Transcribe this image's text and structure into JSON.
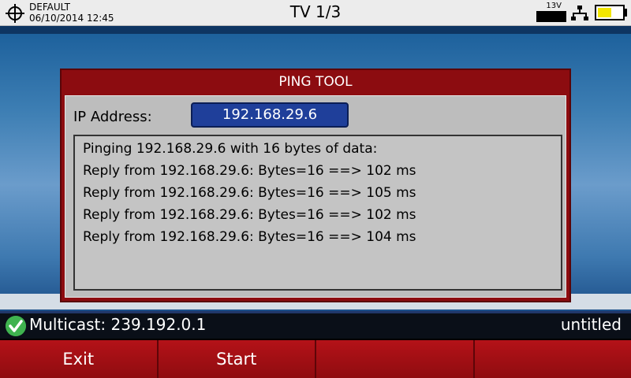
{
  "topbar": {
    "profile_name": "DEFAULT",
    "datetime": "06/10/2014 12:45",
    "title": "TV 1/3",
    "voltage": "13V",
    "battery_level": 0.55,
    "icons": [
      "target-icon",
      "network-icon",
      "battery-icon"
    ]
  },
  "dialog": {
    "title": "PING TOOL",
    "ip_label": "IP Address:",
    "ip_value": "192.168.29.6",
    "output": [
      "Pinging 192.168.29.6 with 16 bytes of data:",
      "Reply from 192.168.29.6: Bytes=16 ==> 102 ms",
      "Reply from 192.168.29.6: Bytes=16 ==> 105 ms",
      "Reply from 192.168.29.6: Bytes=16 ==> 102 ms",
      "Reply from 192.168.29.6: Bytes=16 ==> 104 ms"
    ]
  },
  "status": {
    "multicast": "Multicast: 239.192.0.1",
    "filename": "untitled"
  },
  "fkeys": [
    "Exit",
    "Start",
    "",
    ""
  ],
  "colors": {
    "accent_red": "#8c0c10",
    "ip_field": "#1f3f9a",
    "battery": "#f2e600",
    "check": "#3fb34f"
  }
}
